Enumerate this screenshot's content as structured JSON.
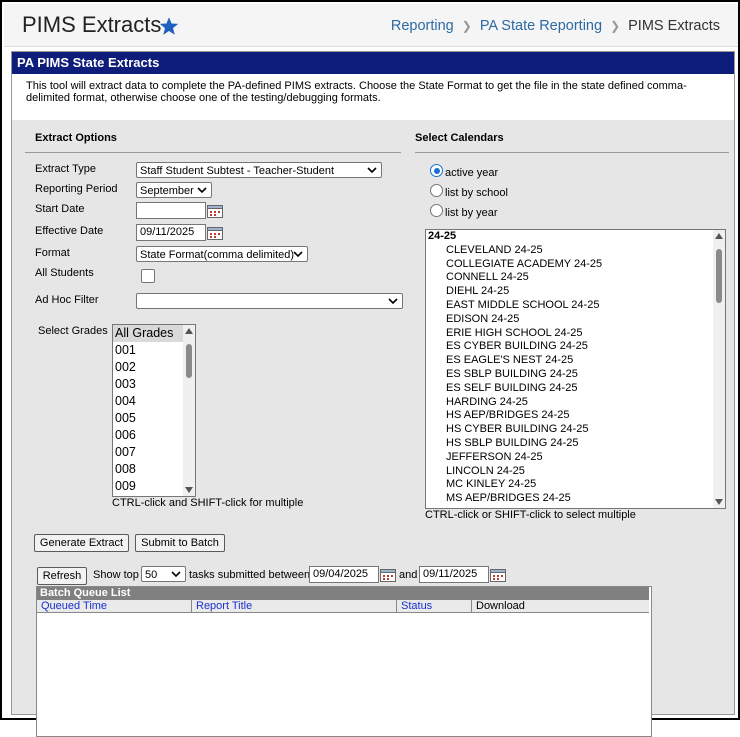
{
  "header": {
    "title": "PIMS Extracts",
    "breadcrumbs": [
      "Reporting",
      "PA State Reporting",
      "PIMS Extracts"
    ]
  },
  "banner": {
    "title": "PA PIMS State Extracts"
  },
  "description": "This tool will extract data to complete the PA-defined PIMS extracts. Choose the State Format to get the file in the state defined comma-delimited format, otherwise choose one of the testing/debugging formats.",
  "extract_options": {
    "heading": "Extract Options",
    "extract_type": {
      "label": "Extract Type",
      "value": "Staff Student Subtest - Teacher-Student"
    },
    "reporting_period": {
      "label": "Reporting Period",
      "value": "September"
    },
    "start_date": {
      "label": "Start Date",
      "value": ""
    },
    "effective_date": {
      "label": "Effective Date",
      "value": "09/11/2025"
    },
    "format": {
      "label": "Format",
      "value": "State Format(comma delimited)"
    },
    "all_students": {
      "label": "All Students",
      "checked": false
    },
    "ad_hoc_filter": {
      "label": "Ad Hoc Filter",
      "value": ""
    },
    "select_grades": {
      "label": "Select Grades",
      "items": [
        "All Grades",
        "001",
        "002",
        "003",
        "004",
        "005",
        "006",
        "007",
        "008",
        "009"
      ],
      "selected": "All Grades",
      "hint": "CTRL-click and SHIFT-click for multiple"
    }
  },
  "select_calendars": {
    "heading": "Select Calendars",
    "options": [
      {
        "label": "active year",
        "selected": true
      },
      {
        "label": "list by school",
        "selected": false
      },
      {
        "label": "list by year",
        "selected": false
      }
    ],
    "group": "24-25",
    "calendars": [
      "CLEVELAND 24-25",
      "COLLEGIATE ACADEMY 24-25",
      "CONNELL 24-25",
      "DIEHL 24-25",
      "EAST MIDDLE SCHOOL 24-25",
      "EDISON 24-25",
      "ERIE HIGH SCHOOL 24-25",
      "ES CYBER BUILDING 24-25",
      "ES EAGLE'S NEST 24-25",
      "ES SBLP BUILDING 24-25",
      "ES SELF BUILDING 24-25",
      "HARDING 24-25",
      "HS AEP/BRIDGES 24-25",
      "HS CYBER BUILDING 24-25",
      "HS SBLP BUILDING 24-25",
      "JEFFERSON 24-25",
      "LINCOLN 24-25",
      "MC KINLEY 24-25",
      "MS AEP/BRIDGES 24-25"
    ],
    "hint": "CTRL-click or SHIFT-click to select multiple"
  },
  "actions": {
    "generate": "Generate Extract",
    "batch": "Submit to Batch"
  },
  "batch_queue": {
    "refresh": "Refresh",
    "show_top": "Show top",
    "count": "50",
    "submitted_between": "tasks submitted between",
    "date_from": "09/04/2025",
    "and": "and",
    "date_to": "09/11/2025",
    "title": "Batch Queue List",
    "columns": [
      "Queued Time",
      "Report Title",
      "Status",
      "Download"
    ]
  },
  "colors": {
    "banner": "#0f1d7a",
    "link": "#2d6aa3",
    "star": "#1f5fbf"
  }
}
